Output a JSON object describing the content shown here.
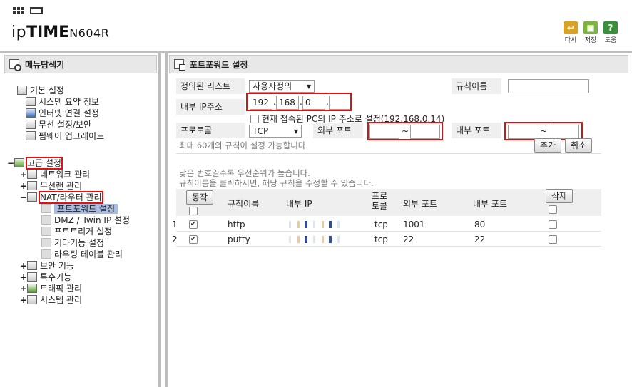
{
  "header": {
    "logo_prefix": "ip",
    "logo_main": "TIME",
    "model": "N604R",
    "buttons": [
      {
        "label": "다시",
        "color": "#d9a227",
        "icon": "undo-icon"
      },
      {
        "label": "저장",
        "color": "#7cb342",
        "icon": "save-icon"
      },
      {
        "label": "도움",
        "color": "#3a8f3a",
        "icon": "help-icon"
      }
    ]
  },
  "sidebar": {
    "title": "메뉴탐색기",
    "sections": {
      "basic": {
        "label": "기본 설정",
        "items": [
          "시스템 요약 정보",
          "인터넷 연결 설정",
          "무선 설정/보안",
          "펌웨어 업그레이드"
        ]
      },
      "advanced": {
        "label": "고급 설정",
        "items": [
          "네트워크 관리",
          "무선랜 관리",
          "NAT/라우터 관리",
          "보안 기능",
          "특수기능",
          "트래픽 관리",
          "시스템 관리"
        ]
      },
      "nat_children": [
        "포트포워드 설정",
        "DMZ / Twin IP 설정",
        "포트트리거 설정",
        "기타기능 설정",
        "라우팅 테이블 관리"
      ]
    },
    "toggles": {
      "expanded": "−",
      "collapsed": "+"
    }
  },
  "main": {
    "title": "포트포워드 설정",
    "form": {
      "predefined_label": "정의된 리스트",
      "predefined_value": "사용자정의",
      "rule_name_label": "규칙이름",
      "rule_name_value": "",
      "internal_ip_label": "내부 IP주소",
      "ip": [
        "192",
        "168",
        "0",
        ""
      ],
      "ip_sep": ".",
      "current_pc_label": "현재 접속된 PC의 IP 주소로 설정(192.168.0.14)",
      "protocol_label": "프로토콜",
      "protocol_value": "TCP",
      "external_port_label": "외부 포트",
      "internal_port_label": "내부 포트",
      "range_sep": "~",
      "max_rules_note": "최대 60개의 규칙이 설정 가능합니다.",
      "add_button": "추가",
      "cancel_button": "취소"
    },
    "hints": [
      "낮은 번호일수록 우선순위가 높습니다.",
      "규칙이름을 클릭하시면, 해당 규칙을 수정할 수 있습니다."
    ],
    "table": {
      "action_button": "동작",
      "delete_button": "삭제",
      "headers": {
        "name": "규칙이름",
        "ip": "내부 IP",
        "proto": "프로\n토콜",
        "ext": "외부 포트",
        "int": "내부 포트"
      },
      "rows": [
        {
          "num": "1",
          "name": "http",
          "proto": "tcp",
          "ext": "1001",
          "int": "80",
          "enabled": true
        },
        {
          "num": "2",
          "name": "putty",
          "proto": "tcp",
          "ext": "22",
          "int": "22",
          "enabled": true
        }
      ]
    }
  }
}
